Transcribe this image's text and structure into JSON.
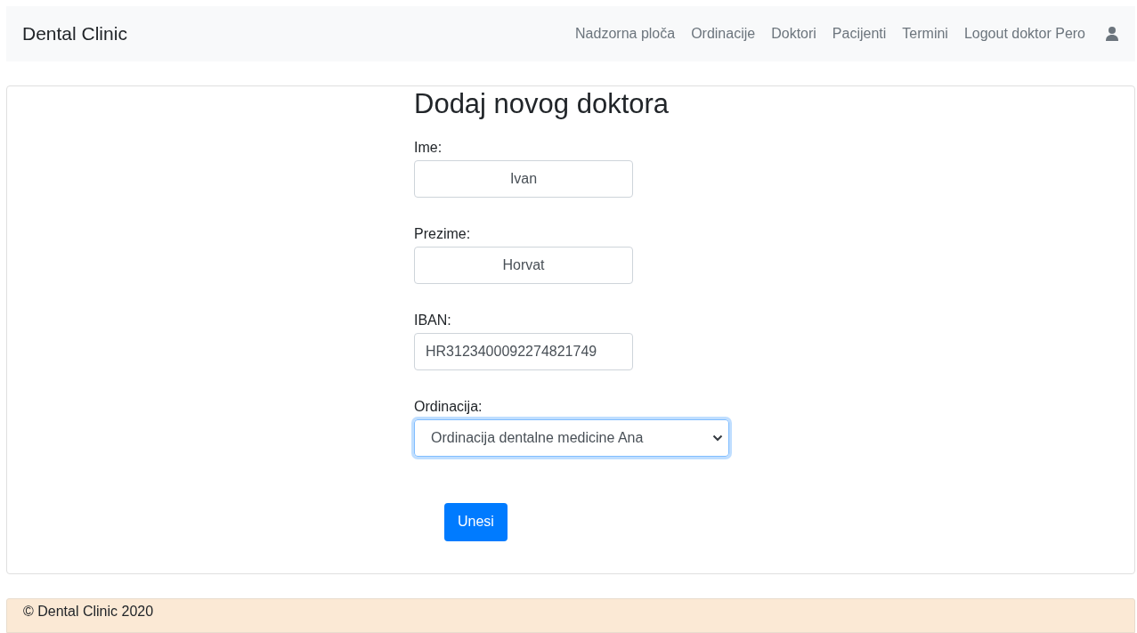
{
  "navbar": {
    "brand": "Dental Clinic",
    "links": [
      {
        "label": "Nadzorna ploča"
      },
      {
        "label": "Ordinacije"
      },
      {
        "label": "Doktori"
      },
      {
        "label": "Pacijenti"
      },
      {
        "label": "Termini"
      },
      {
        "label": "Logout doktor Pero"
      }
    ]
  },
  "form": {
    "title": "Dodaj novog doktora",
    "fields": [
      {
        "kind": "centered",
        "label": "Ime:",
        "value": "Ivan"
      },
      {
        "kind": "centered",
        "label": "Prezime:",
        "value": "Horvat"
      },
      {
        "kind": "text",
        "label": "IBAN:",
        "value": "HR3123400092274821749"
      },
      {
        "kind": "select",
        "label": "Ordinacija:",
        "value": "Ordinacija dentalne medicine Ana",
        "focused": true
      }
    ],
    "submit": "Unesi"
  },
  "footer": {
    "text": "© Dental Clinic 2020"
  }
}
